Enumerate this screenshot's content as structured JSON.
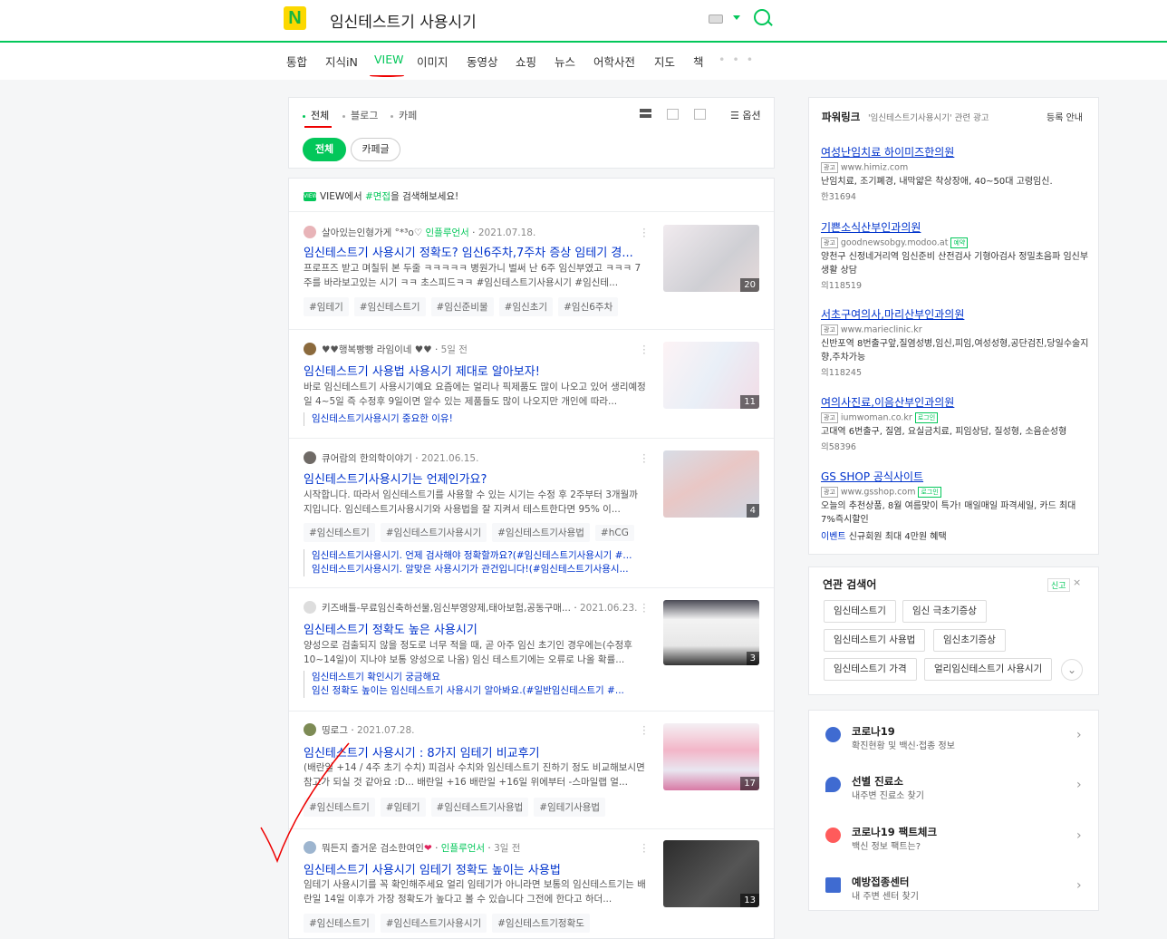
{
  "search": {
    "logo": "N",
    "query": "임신테스트기 사용시기"
  },
  "tabs": [
    "통합",
    "지식iN",
    "VIEW",
    "이미지",
    "동영상",
    "쇼핑",
    "뉴스",
    "어학사전",
    "지도",
    "책",
    "• • •"
  ],
  "filters": {
    "items": [
      "전체",
      "블로그",
      "카페"
    ],
    "option_label": "옵션",
    "chips": [
      "전체",
      "카페글"
    ]
  },
  "suggest": {
    "badge": "VIEW",
    "pre": "VIEW에서 ",
    "kw": "#면접",
    "post": "을 검색해보세요!"
  },
  "results": [
    {
      "author": "살아있는인형가게 °*³o♡",
      "influencer": "인플루언서",
      "date": "2021.07.18.",
      "title": "임신테스트기 사용시기 정확도? 임신6주차,7주차 증상 임테기 경...",
      "desc": "프로프즈 받고 며칠뒤 본 두줄 ㅋㅋㅋㅋㅋ 병원가니 벌써 난 6주 임신부였고 ㅋㅋㅋ 7주를 바라보고있는 시기 ㅋㅋ 초스피드ㅋㅋ #임신테스트기사용시기 #임신테...",
      "tags": [
        "#임테기",
        "#임신테스트기",
        "#임신준비물",
        "#임신초기",
        "#임신6주차"
      ],
      "count": "20"
    },
    {
      "author": "♥♥행복빵빵 라임이네 ♥♥",
      "date": "5일 전",
      "title": "임신테스트기 사용법 사용시기 제대로 알아보자!",
      "desc": "바로 임신테스트기 사용시기예요 요즘에는 얼리나 픽제품도 많이 나오고 있어 생리예정일 4~5일 즉 수정후 9일이면 알수 있는 제품들도 많이 나오지만 개인에 따라...",
      "subs": [
        "임신테스트기사용시기 중요한 이유!"
      ],
      "count": "11"
    },
    {
      "author": "큐어람의 한의학이야기",
      "date": "2021.06.15.",
      "title": "임신테스트기사용시기는 언제인가요?",
      "desc": "시작합니다. 따라서 임신테스트기를 사용할 수 있는 시기는 수정 후 2주부터 3개월까지입니다. 임신테스트기사용시기와 사용법을 잘 지켜서 테스트한다면 95% 이...",
      "tags": [
        "#임신테스트기",
        "#임신테스트기사용시기",
        "#임신테스트기사용법",
        "#hCG"
      ],
      "subs": [
        "임신테스트기사용시기. 언제 검사해야 정확할까요?(#임신테스트기사용시기 #...",
        "임신테스트기사용시기. 알맞은 사용시기가 관건입니다!(#임신테스트기사용시..."
      ],
      "count": "4"
    },
    {
      "author": "키즈배틀-무료임신축하선물,임신부영양제,태아보험,공동구매...",
      "date": "2021.06.23.",
      "title": "임신테스트기 정확도 높은 사용시기",
      "desc": "양성으로 검출되지 않을 정도로 너무 적을 때, 곧 아주 임신 초기인 경우에는(수정후 10~14일)이 지나야 보통 양성으로 나옴) 임신 테스트기에는 오류로 나올 확률...",
      "subs": [
        "임신테스트기 확인시기 궁금해요",
        "임신 정확도 높이는 임신테스트기 사용시기 알아봐요.(#일반임신테스트기 #..."
      ],
      "count": "3"
    },
    {
      "author": "띵로그",
      "date": "2021.07.28.",
      "title": "임신테스트기 사용시기 : 8가지 임테기 비교후기",
      "desc": "(배란일 +14 / 4주 초기 수치) 피검사 수치와 임신테스트기 진하기 정도 비교해보시면 참고가 되실 것 같아요 :D... 배란일 +16 배란일 +16일 위에부터 -스마일랩 얼...",
      "tags": [
        "#임신테스트기",
        "#임테기",
        "#임신테스트기사용법",
        "#임테기사용법"
      ],
      "count": "17"
    },
    {
      "author": "뭐든지 즐거운 검소한여인",
      "influencer": "인플루언서",
      "date": "3일 전",
      "title": "임신테스트기 사용시기 임테기 정확도 높이는 사용법",
      "desc": "임테기 사용시기를 꼭 확인해주세요 얼리 임테기가 아니라면 보통의 임신테스트기는 배란일 14일 이후가 가장 정확도가 높다고 볼 수 있습니다 그전에 한다고 하더...",
      "tags": [
        "#임신테스트기",
        "#임신테스트기사용시기",
        "#임신테스트기정확도"
      ],
      "count": "13"
    }
  ],
  "powerlink": {
    "title": "파워링크",
    "subtitle": "'임신테스트기사용시기' 관련 광고",
    "register": "등록 안내",
    "ads": [
      {
        "title": "여성난임치료 하이미즈한의원",
        "badge": "광고",
        "url": "www.himiz.com",
        "desc": "난임치료, 조기폐경, 내막얇은 착상장애, 40~50대 고령임신.",
        "count": "한31694"
      },
      {
        "title": "기쁜소식산부인과의원",
        "badge": "광고",
        "url": "goodnewsobgy.modoo.at",
        "nbadge": "예약",
        "desc": "양천구 신정네거리역 임신준비 산전검사 기형아검사 정밀초음파 임신부 생활 상담",
        "count": "의118519"
      },
      {
        "title": "서초구여의사,마리산부인과의원",
        "badge": "광고",
        "url": "www.marieclinic.kr",
        "desc": "신반포역 8번출구앞,질염성병,임신,피임,여성성형,공단검진,당일수술지향,주차가능",
        "count": "의118245"
      },
      {
        "title": "여의사진료,이음산부인과의원",
        "badge": "광고",
        "url": "iumwoman.co.kr",
        "nbadge": "로그인",
        "desc": "고대역 6번출구, 질염, 요실금치료, 피임상담, 질성형, 소음순성형",
        "count": "의58396"
      },
      {
        "title": "GS SHOP 공식사이트",
        "badge": "광고",
        "url": "www.gsshop.com",
        "nbadge": "로그인",
        "desc": "오늘의 추천상품, 8월 여름맞이 특가! 매일매일 파격세일, 카드 최대7%즉시할인",
        "event_label": "이벤트",
        "event_text": " 신규회원 최대 4만원 혜택"
      }
    ]
  },
  "related": {
    "title": "연관 검색어",
    "new": "신고",
    "close": "×",
    "keywords": [
      "임신테스트기",
      "임신 극초기증상",
      "임신테스트기 사용법",
      "임신초기증상",
      "임신테스트기 가격",
      "얼리임신테스트기 사용시기"
    ]
  },
  "covid": [
    {
      "title": "코로나19",
      "desc": "확진현황 및 백신·접종 정보"
    },
    {
      "title": "선별 진료소",
      "desc": "내주변 진료소 찾기"
    },
    {
      "title": "코로나19 팩트체크",
      "desc": "백신 정보 팩트는?"
    },
    {
      "title": "예방접종센터",
      "desc": "내 주변 센터 찾기"
    }
  ],
  "colors": {
    "accent": "#03c75a",
    "link": "#0033cc",
    "annotation": "#e00000"
  }
}
